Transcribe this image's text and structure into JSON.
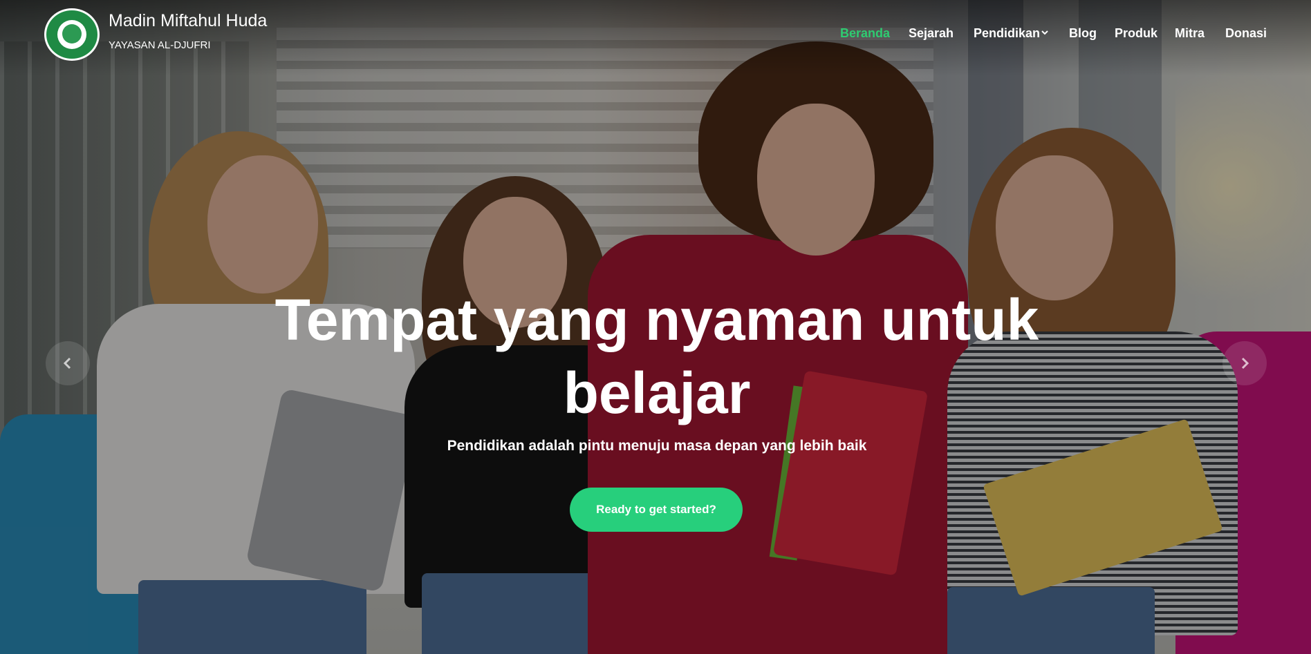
{
  "brand": {
    "name": "Madin Miftahul Huda",
    "subtitle": "YAYASAN AL-DJUFRI",
    "logo_icon": "school-emblem-logo"
  },
  "nav": {
    "items": [
      {
        "label": "Beranda",
        "active": true
      },
      {
        "label": "Sejarah",
        "active": false
      },
      {
        "label": "Pendidikan",
        "active": false,
        "has_dropdown": true
      },
      {
        "label": "Blog",
        "active": false
      },
      {
        "label": "Produk",
        "active": false
      },
      {
        "label": "Mitra",
        "active": false
      },
      {
        "label": "Donasi",
        "active": false
      }
    ],
    "dropdown_icon": "chevron-down-icon"
  },
  "hero": {
    "headline_line1": "Tempat yang nyaman untuk",
    "headline_line2": "belajar",
    "subtitle": "Pendidikan adalah pintu menuju masa depan yang lebih baik",
    "cta_label": "Ready to get started?",
    "prev_icon": "chevron-left-icon",
    "next_icon": "chevron-right-icon"
  },
  "colors": {
    "accent": "#27cf7c",
    "active_nav": "#2ecc71",
    "text": "#ffffff"
  }
}
